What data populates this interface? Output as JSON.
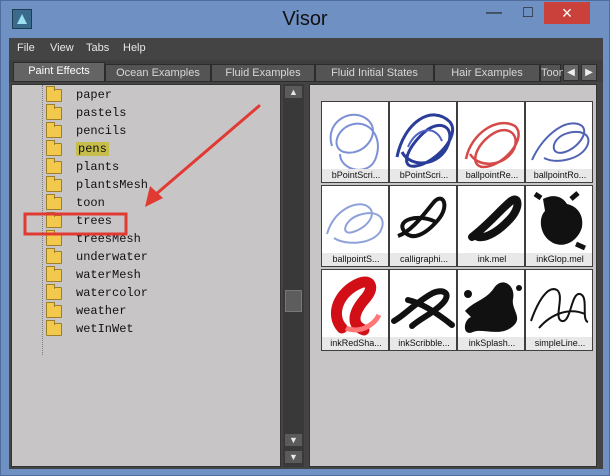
{
  "window": {
    "title": "Visor"
  },
  "controls": {
    "minimize": "—",
    "maximize": "□",
    "close": "×"
  },
  "menu": [
    "File",
    "View",
    "Tabs",
    "Help"
  ],
  "tabs": [
    "Paint Effects",
    "Ocean Examples",
    "Fluid Examples",
    "Fluid Initial States",
    "Hair Examples",
    "Toon"
  ],
  "tab_arrows": [
    "◀",
    "▶"
  ],
  "folders": [
    "paper",
    "pastels",
    "pencils",
    "pens",
    "plants",
    "plantsMesh",
    "toon",
    "trees",
    "treesMesh",
    "underwater",
    "waterMesh",
    "watercolor",
    "weather",
    "wetInWet"
  ],
  "brushes": [
    "bPointScri...",
    "bPointScri...",
    "ballpointRe...",
    "ballpointRo...",
    "ballpointS...",
    "calligraphi...",
    "ink.mel",
    "inkGlop.mel",
    "inkRedSha...",
    "inkScribble...",
    "inkSplash...",
    "simpleLine..."
  ],
  "icons": {
    "folder": "folder-icon",
    "up": "▲",
    "down": "▼"
  },
  "colors": {
    "window_blue": "#6f90c3",
    "dark_chrome": "#444444",
    "panel_gray": "#c8c5c7",
    "pens_highlight": "#c7bd4b",
    "annotation_red": "#e03a33"
  }
}
